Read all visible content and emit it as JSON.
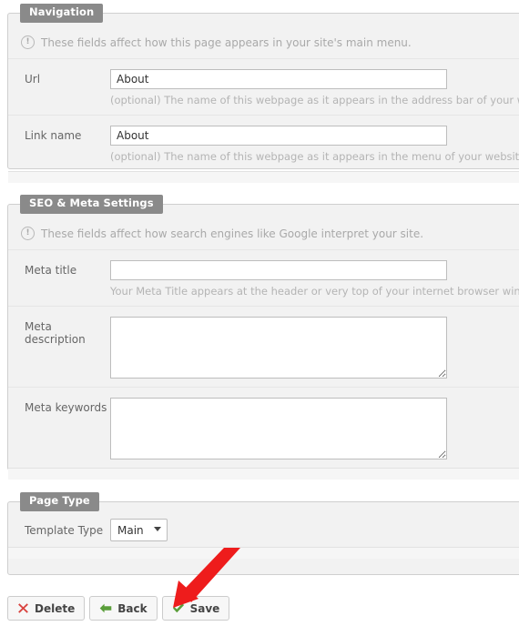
{
  "panels": [
    {
      "legend": "Navigation",
      "note": {
        "icon": "info-exclamation-icon",
        "text": "These fields affect how this page appears in your site's main menu."
      },
      "rows": [
        {
          "label": "Url",
          "type": "text",
          "value": "About",
          "placeholder": "",
          "hint": "(optional) The name of this webpage as it appears in the address bar of your web browser."
        },
        {
          "label": "Link name",
          "type": "text",
          "value": "About",
          "placeholder": "",
          "hint": "(optional) The name of this webpage as it appears in the menu of your website. Leave blank to hide."
        }
      ]
    },
    {
      "legend": "SEO & Meta Settings",
      "note": {
        "icon": "info-exclamation-icon",
        "text": "These fields affect how search engines like Google interpret your site."
      },
      "rows": [
        {
          "label": "Meta title",
          "type": "text",
          "value": "",
          "placeholder": "",
          "hint": "Your Meta Title appears at the header or very top of your internet browser window, and in search results."
        },
        {
          "label": "Meta description",
          "type": "textarea",
          "value": "",
          "placeholder": "",
          "hint": ""
        },
        {
          "label": "Meta keywords",
          "type": "textarea",
          "value": "",
          "placeholder": "",
          "hint": ""
        }
      ]
    },
    {
      "legend": "Page Type",
      "note": null,
      "rows": [
        {
          "label": "Template Type",
          "type": "select",
          "value": "Main",
          "options": [
            "Main"
          ],
          "hint": ""
        }
      ]
    }
  ],
  "buttons": [
    {
      "label": "Delete",
      "icon": "red-x-icon",
      "color": "#d9433f"
    },
    {
      "label": "Back",
      "icon": "green-left-arrow-icon",
      "color": "#5a9e3a"
    },
    {
      "label": "Save",
      "icon": "green-check-icon",
      "color": "#5a9e3a"
    }
  ],
  "annotation": {
    "name": "red-arrow-pointing-to-save",
    "color": "#ee1c1c"
  },
  "colors": {
    "legend_bg": "#8a8a8a",
    "panel_bg": "#f2f2f2",
    "panel_border": "#cfcfcf",
    "hint_text": "#b4b4b4",
    "label_text": "#666666",
    "input_border": "#bdbdbd"
  }
}
